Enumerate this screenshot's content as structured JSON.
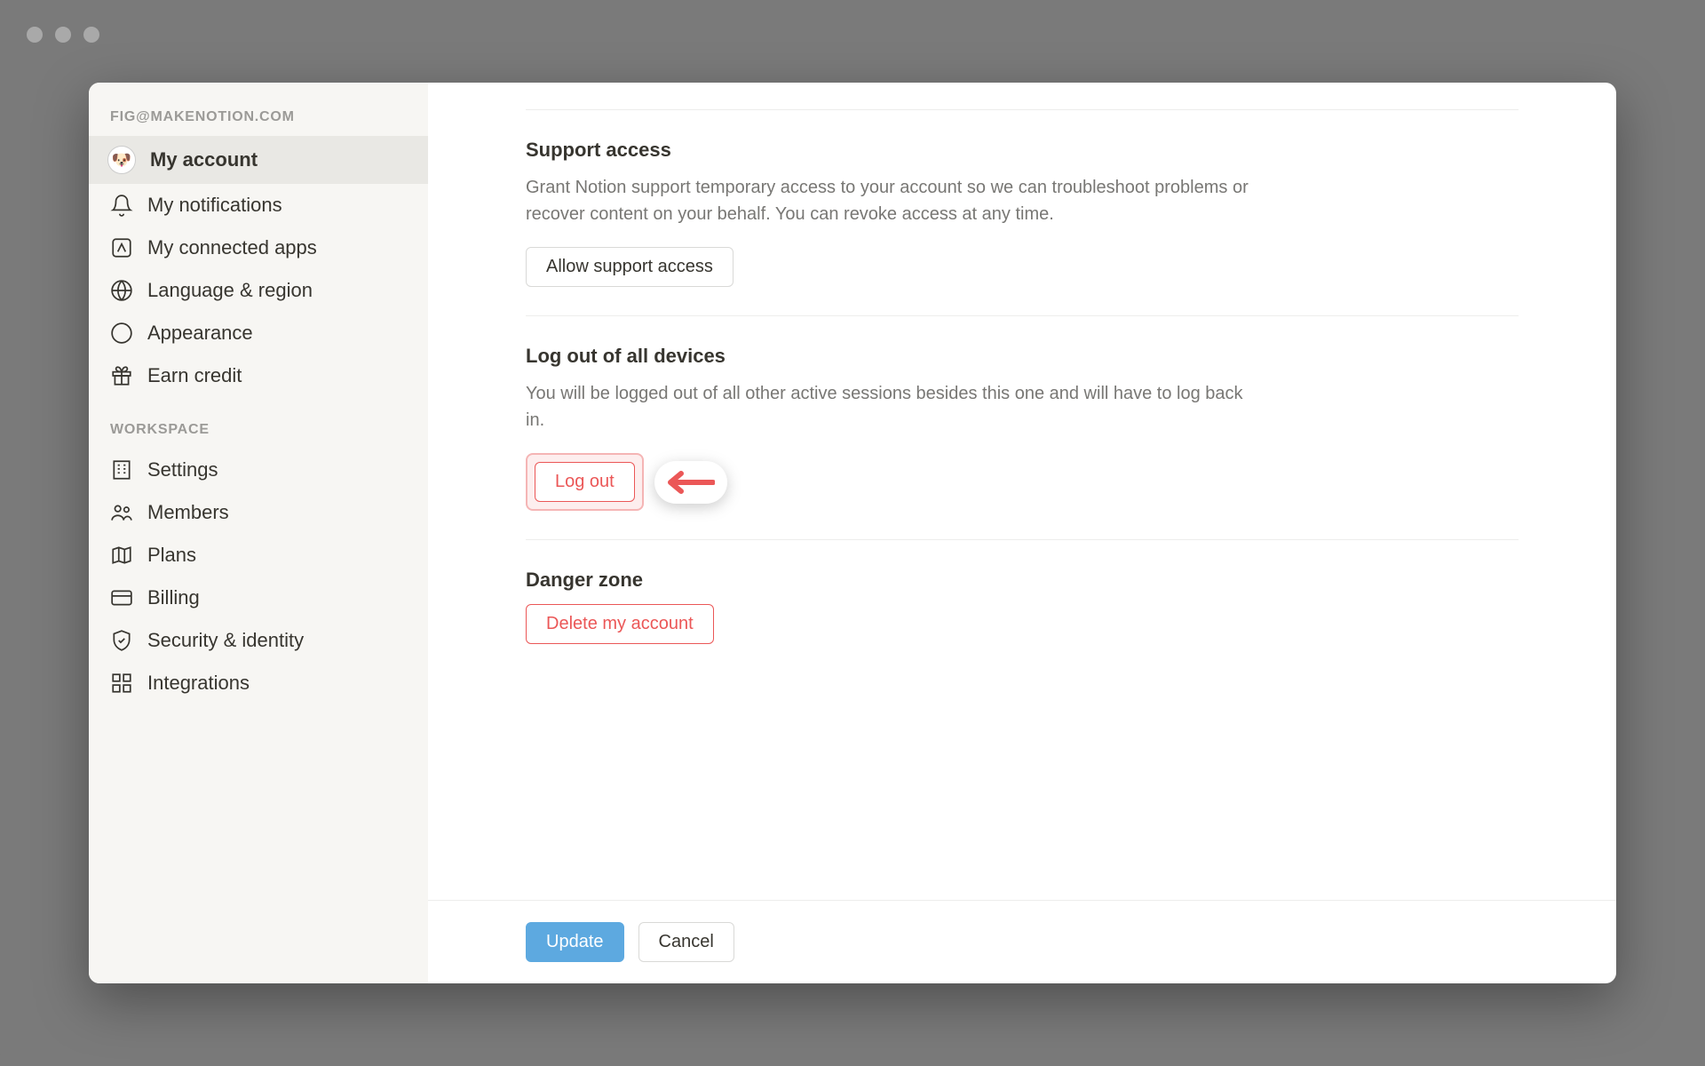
{
  "sidebar": {
    "account_header": "FIG@MAKENOTION.COM",
    "workspace_header": "WORKSPACE",
    "items_account": [
      {
        "label": "My account",
        "icon": "avatar"
      },
      {
        "label": "My notifications",
        "icon": "bell"
      },
      {
        "label": "My connected apps",
        "icon": "app"
      },
      {
        "label": "Language & region",
        "icon": "globe"
      },
      {
        "label": "Appearance",
        "icon": "moon"
      },
      {
        "label": "Earn credit",
        "icon": "gift"
      }
    ],
    "items_workspace": [
      {
        "label": "Settings",
        "icon": "building"
      },
      {
        "label": "Members",
        "icon": "people"
      },
      {
        "label": "Plans",
        "icon": "map"
      },
      {
        "label": "Billing",
        "icon": "card"
      },
      {
        "label": "Security & identity",
        "icon": "shield"
      },
      {
        "label": "Integrations",
        "icon": "grid"
      }
    ]
  },
  "sections": {
    "support": {
      "title": "Support access",
      "desc": "Grant Notion support temporary access to your account so we can troubleshoot problems or recover content on your behalf. You can revoke access at any time.",
      "button": "Allow support access"
    },
    "logout": {
      "title": "Log out of all devices",
      "desc": "You will be logged out of all other active sessions besides this one and will have to log back in.",
      "button": "Log out"
    },
    "danger": {
      "title": "Danger zone",
      "button": "Delete my account"
    }
  },
  "footer": {
    "update": "Update",
    "cancel": "Cancel"
  }
}
